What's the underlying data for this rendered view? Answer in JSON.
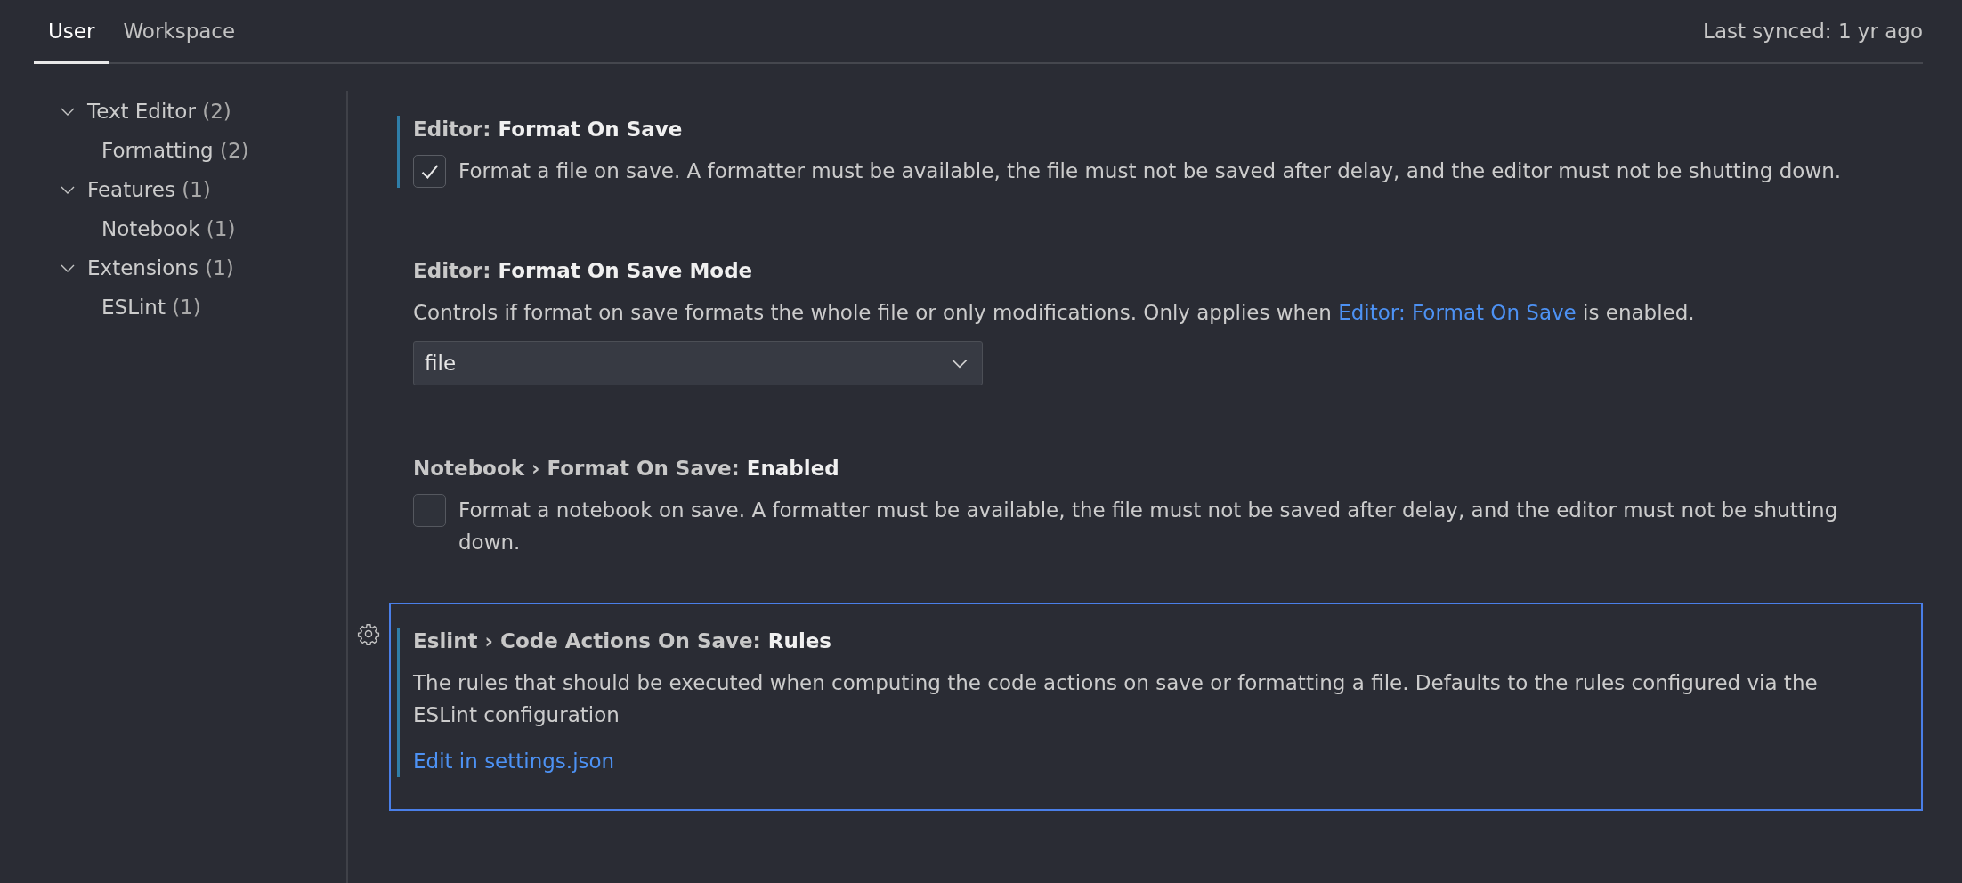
{
  "tabs": [
    {
      "label": "User",
      "selected": true
    },
    {
      "label": "Workspace",
      "selected": false
    }
  ],
  "last_synced": "Last synced: 1 yr ago",
  "tree": [
    {
      "label": "Text Editor",
      "count": "(2)",
      "expanded": true,
      "children": [
        {
          "label": "Formatting",
          "count": "(2)"
        }
      ]
    },
    {
      "label": "Features",
      "count": "(1)",
      "expanded": true,
      "children": [
        {
          "label": "Notebook",
          "count": "(1)"
        }
      ]
    },
    {
      "label": "Extensions",
      "count": "(1)",
      "expanded": true,
      "children": [
        {
          "label": "ESLint",
          "count": "(1)"
        }
      ]
    }
  ],
  "settings": [
    {
      "kind": "checkbox",
      "category": "Editor: ",
      "name": "Format On Save",
      "modified": true,
      "focused": false,
      "checked": true,
      "description": [
        {
          "text": "Format a file on save. A formatter must be available, the file must not be saved after delay, and the editor must not be shutting down.",
          "link": false
        }
      ]
    },
    {
      "kind": "dropdown",
      "category": "Editor: ",
      "name": "Format On Save Mode",
      "modified": false,
      "focused": false,
      "value": "file",
      "description": [
        {
          "text": "Controls if format on save formats the whole file or only modifications. Only applies when ",
          "link": false
        },
        {
          "text": "Editor: Format On Save",
          "link": true
        },
        {
          "text": " is enabled.",
          "link": false
        }
      ]
    },
    {
      "kind": "checkbox",
      "category": "Notebook › Format On Save: ",
      "name": "Enabled",
      "modified": false,
      "focused": false,
      "checked": false,
      "description": [
        {
          "text": "Format a notebook on save. A formatter must be available, the file must not be saved after delay, and the editor must not be shutting down.",
          "link": false
        }
      ]
    },
    {
      "kind": "link",
      "category": "Eslint › Code Actions On Save: ",
      "name": "Rules",
      "modified": true,
      "focused": true,
      "link_text": "Edit in settings.json",
      "description": [
        {
          "text": "The rules that should be executed when computing the code actions on save or formatting a file. Defaults to the rules configured via the ESLint configuration",
          "link": false
        }
      ]
    }
  ]
}
